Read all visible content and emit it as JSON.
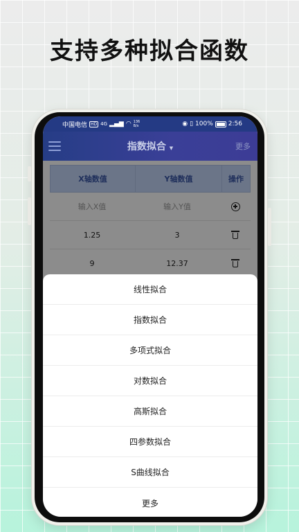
{
  "headline": "支持多种拟合函数",
  "status_bar": {
    "carrier": "中国电信",
    "hd": "HD",
    "signal": "4G",
    "speed_value": "136",
    "speed_unit": "B/s",
    "battery": "100%",
    "time": "2:56"
  },
  "app_bar": {
    "title": "指数拟合",
    "more_label": "更多"
  },
  "table": {
    "headers": [
      "X轴数值",
      "Y轴数值",
      "操作"
    ],
    "input_placeholders": {
      "x": "输入X值",
      "y": "输入Y值"
    },
    "rows": [
      {
        "x": "1.25",
        "y": "3"
      },
      {
        "x": "9",
        "y": "12.37"
      }
    ]
  },
  "fit_menu": {
    "items": [
      "线性拟合",
      "指数拟合",
      "多项式拟合",
      "对数拟合",
      "高斯拟合",
      "四参数拟合",
      "S曲线拟合",
      "更多"
    ]
  },
  "colors": {
    "app_bar": "#263d86",
    "table_header": "#c4d6f8",
    "header_text": "#3956a6"
  }
}
